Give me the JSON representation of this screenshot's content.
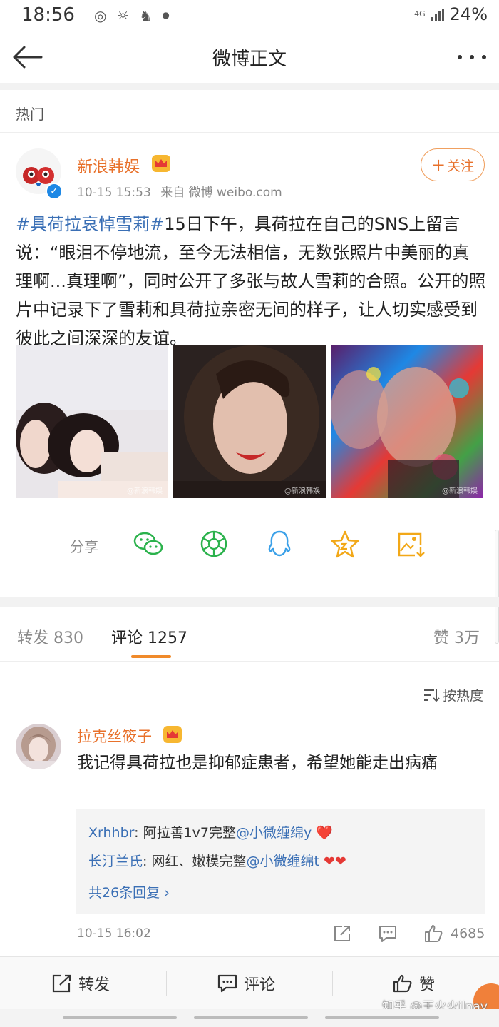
{
  "status_bar": {
    "time": "18:56",
    "network": "4G",
    "battery": "24%"
  },
  "nav": {
    "title": "微博正文"
  },
  "section": {
    "hot_label": "热门"
  },
  "post": {
    "author": "新浪韩娱",
    "avatar_text": "新浪韩娱",
    "time": "10-15 15:53",
    "source": "来自 微博 weibo.com",
    "follow_label": "关注",
    "hashtag": "#具荷拉哀悼雪莉#",
    "text": "15日下午，具荷拉在自己的SNS上留言说：“眼泪不停地流，至今无法相信，无数张照片中美丽的真理啊...真理啊”，同时公开了多张与故人雪莉的合照。公开的照片中记录下了雪莉和具荷拉亲密无间的样子，让人切实感受到彼此之间深深的友谊。",
    "image_watermark": "@新浪韩娱"
  },
  "share": {
    "label": "分享",
    "icons": [
      "wechat-icon",
      "moments-icon",
      "qq-icon",
      "favorite-star-icon",
      "save-image-icon"
    ]
  },
  "tabs": {
    "repost": "转发 830",
    "comment": "评论 1257",
    "like": "赞 3万"
  },
  "sort": {
    "label": "按热度"
  },
  "comment": {
    "user": "拉克丝筱子",
    "text": "我记得具荷拉也是抑郁症患者，希望她能走出病痛",
    "replies": [
      {
        "user": "Xrhhbr",
        "text": "阿拉善1v7完整",
        "mention": "@小微缠绵y",
        "emoji": "❤️"
      },
      {
        "user": "长汀兰氏",
        "text": "网红、嫩模完整",
        "mention": "@小微缠绵t",
        "emoji": "❤❤"
      }
    ],
    "more_replies": "共26条回复 ›",
    "time": "10-15 16:02",
    "likes": "4685"
  },
  "bottom_bar": {
    "repost": "转发",
    "comment": "评论",
    "like": "赞"
  },
  "watermark": "知乎 @王火火ilnay",
  "colors": {
    "accent_orange": "#e8712b",
    "link_blue": "#3a6fb5",
    "tab_underline": "#f08a2a"
  }
}
